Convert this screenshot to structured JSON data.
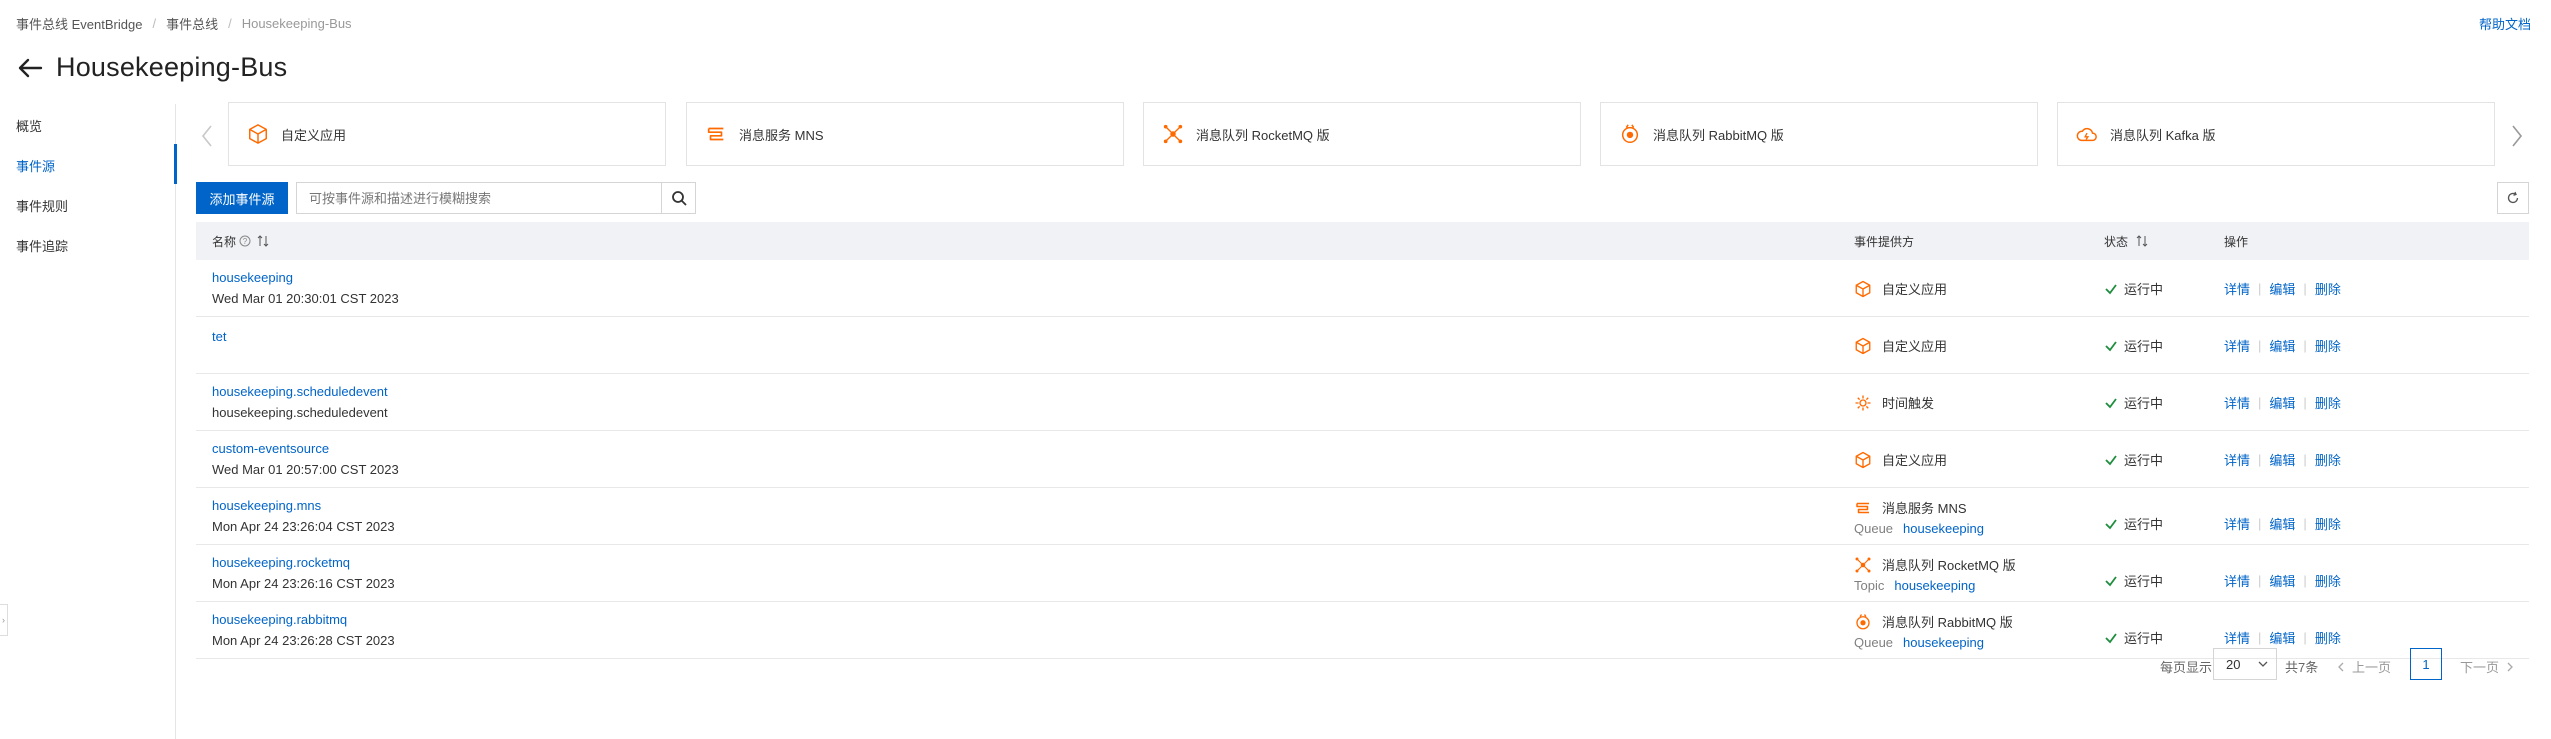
{
  "breadcrumb": [
    "事件总线 EventBridge",
    "事件总线",
    "Housekeeping-Bus"
  ],
  "help_link": "帮助文档",
  "page_title": "Housekeeping-Bus",
  "colors": {
    "accent": "#0064c8",
    "provider_orange": "#ff6a00",
    "success": "#1e8e3e"
  },
  "sidenav": [
    {
      "label": "概览",
      "active": false
    },
    {
      "label": "事件源",
      "active": true
    },
    {
      "label": "事件规则",
      "active": false
    },
    {
      "label": "事件追踪",
      "active": false
    }
  ],
  "providers": [
    {
      "label": "自定义应用",
      "icon": "cube-icon"
    },
    {
      "label": "消息服务 MNS",
      "icon": "mns-icon"
    },
    {
      "label": "消息队列 RocketMQ 版",
      "icon": "rocketmq-icon"
    },
    {
      "label": "消息队列 RabbitMQ 版",
      "icon": "rabbitmq-icon"
    },
    {
      "label": "消息队列 Kafka 版",
      "icon": "kafka-icon"
    }
  ],
  "toolbar": {
    "add_label": "添加事件源",
    "search_placeholder": "可按事件源和描述进行模糊搜索"
  },
  "table": {
    "columns": {
      "name": "名称",
      "provider": "事件提供方",
      "status": "状态",
      "actions": "操作"
    },
    "action_labels": {
      "detail": "详情",
      "edit": "编辑",
      "delete": "删除"
    },
    "rows": [
      {
        "name": "housekeeping",
        "sub": "Wed Mar 01 20:30:01 CST 2023",
        "provider": "自定义应用",
        "provider_icon": "cube-icon",
        "prov_key": "",
        "prov_val": "",
        "status": "运行中"
      },
      {
        "name": "tet",
        "sub": "",
        "provider": "自定义应用",
        "provider_icon": "cube-icon",
        "prov_key": "",
        "prov_val": "",
        "status": "运行中"
      },
      {
        "name": "housekeeping.scheduledevent",
        "sub": "housekeeping.scheduledevent",
        "provider": "时间触发",
        "provider_icon": "timer-gear-icon",
        "prov_key": "",
        "prov_val": "",
        "status": "运行中"
      },
      {
        "name": "custom-eventsource",
        "sub": "Wed Mar 01 20:57:00 CST 2023",
        "provider": "自定义应用",
        "provider_icon": "cube-icon",
        "prov_key": "",
        "prov_val": "",
        "status": "运行中"
      },
      {
        "name": "housekeeping.mns",
        "sub": "Mon Apr 24 23:26:04 CST 2023",
        "provider": "消息服务 MNS",
        "provider_icon": "mns-icon",
        "prov_key": "Queue",
        "prov_val": "housekeeping",
        "status": "运行中"
      },
      {
        "name": "housekeeping.rocketmq",
        "sub": "Mon Apr 24 23:26:16 CST 2023",
        "provider": "消息队列 RocketMQ 版",
        "provider_icon": "rocketmq-icon",
        "prov_key": "Topic",
        "prov_val": "housekeeping",
        "status": "运行中"
      },
      {
        "name": "housekeeping.rabbitmq",
        "sub": "Mon Apr 24 23:26:28 CST 2023",
        "provider": "消息队列 RabbitMQ 版",
        "provider_icon": "rabbitmq-icon",
        "prov_key": "Queue",
        "prov_val": "housekeeping",
        "status": "运行中"
      }
    ]
  },
  "pagination": {
    "per_page_label": "每页显示",
    "per_page_value": "20",
    "total": "共7条",
    "prev": "上一页",
    "current": "1",
    "next": "下一页"
  }
}
